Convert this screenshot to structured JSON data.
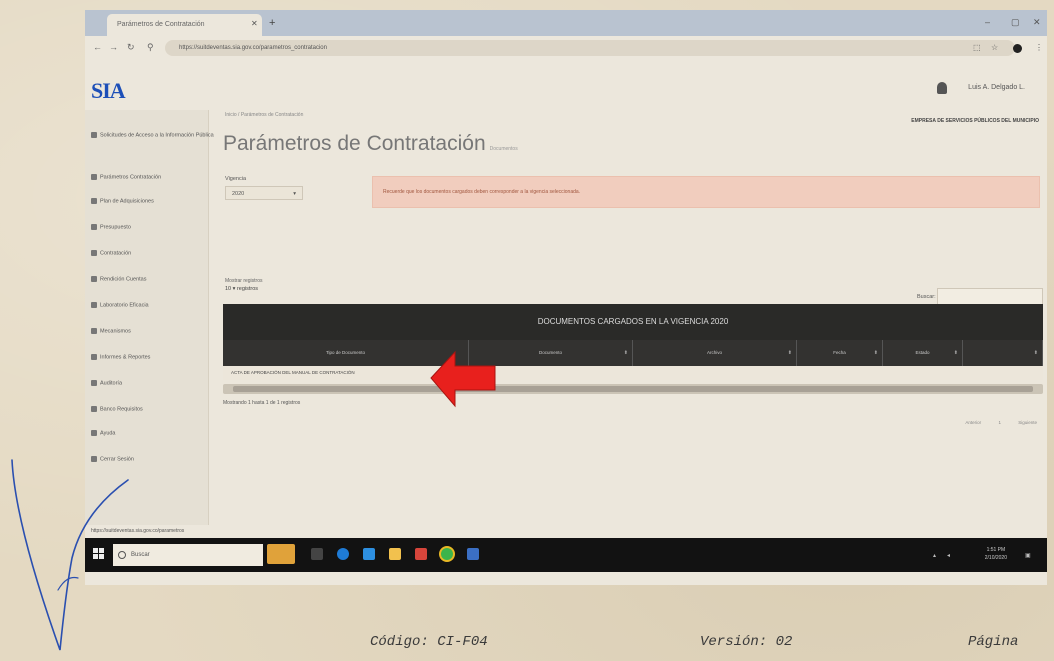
{
  "browser": {
    "tab_title": "Parámetros de Contratación",
    "url": "https://suitdeventas.sia.gov.co/parametros_contratacion"
  },
  "header": {
    "logo_text": "SIA",
    "logo_sub": "",
    "user_name": "Luis A. Delgado L."
  },
  "sidebar": {
    "items": [
      {
        "label": "Solicitudes de Acceso a la Información Pública",
        "icon": "gear-icon"
      },
      {
        "label": "Parámetros Contratación",
        "icon": "gear-icon"
      },
      {
        "label": "Plan de Adquisiciones",
        "icon": "cart-icon"
      },
      {
        "label": "Presupuesto",
        "icon": "chart-icon"
      },
      {
        "label": "Contratación",
        "icon": "doc-icon"
      },
      {
        "label": "Rendición Cuentas",
        "icon": "doc-icon"
      },
      {
        "label": "Laboratorio Eficacia",
        "icon": "lab-icon"
      },
      {
        "label": "Mecanismos",
        "icon": "user-icon"
      },
      {
        "label": "Informes & Reportes",
        "icon": "report-icon"
      },
      {
        "label": "Auditoría",
        "icon": "search-icon"
      },
      {
        "label": "Banco Requisitos",
        "icon": "bank-icon"
      },
      {
        "label": "Ayuda",
        "icon": "help-icon"
      },
      {
        "label": "Cerrar Sesión",
        "icon": "logout-icon"
      }
    ]
  },
  "page": {
    "breadcrumb": "Inicio / Parámetros de Contratación",
    "entity": "EMPRESA DE SERVICIOS PÚBLICOS DEL MUNICIPIO",
    "title": "Parámetros de Contratación",
    "title_small": "Documentos",
    "vigencia_label": "Vigencia",
    "vigencia_value": "2020",
    "alert_text": "Recuerde que los documentos cargados deben corresponder a la vigencia seleccionada.",
    "show_label": "Mostrar registros",
    "show_value": "10",
    "show_suffix": "registros",
    "search_label": "Buscar:",
    "table_title": "DOCUMENTOS CARGADOS EN LA VIGENCIA 2020",
    "columns": [
      "Tipo de Documento",
      "Documento",
      "Archivo",
      "Fecha",
      "Estado",
      ""
    ],
    "row_text": "ACTA DE APROBACIÓN DEL MANUAL DE CONTRATACIÓN",
    "info_text": "Mostrando 1 hasta 1 de 1 registros",
    "pager": [
      "Anterior",
      "1",
      "Siguiente"
    ]
  },
  "status_text": "https://suitdeventas.sia.gov.co/parametros",
  "taskbar": {
    "search_placeholder": "Buscar",
    "time": "1:51 PM",
    "date": "2/10/2020"
  },
  "footer": {
    "code": "Código: CI-F04",
    "version": "Versión: 02",
    "page": "Página"
  },
  "colors": {
    "arrow": "#e8201d",
    "alert_bg": "#f1cdbe",
    "table_header": "#2a2a28"
  }
}
